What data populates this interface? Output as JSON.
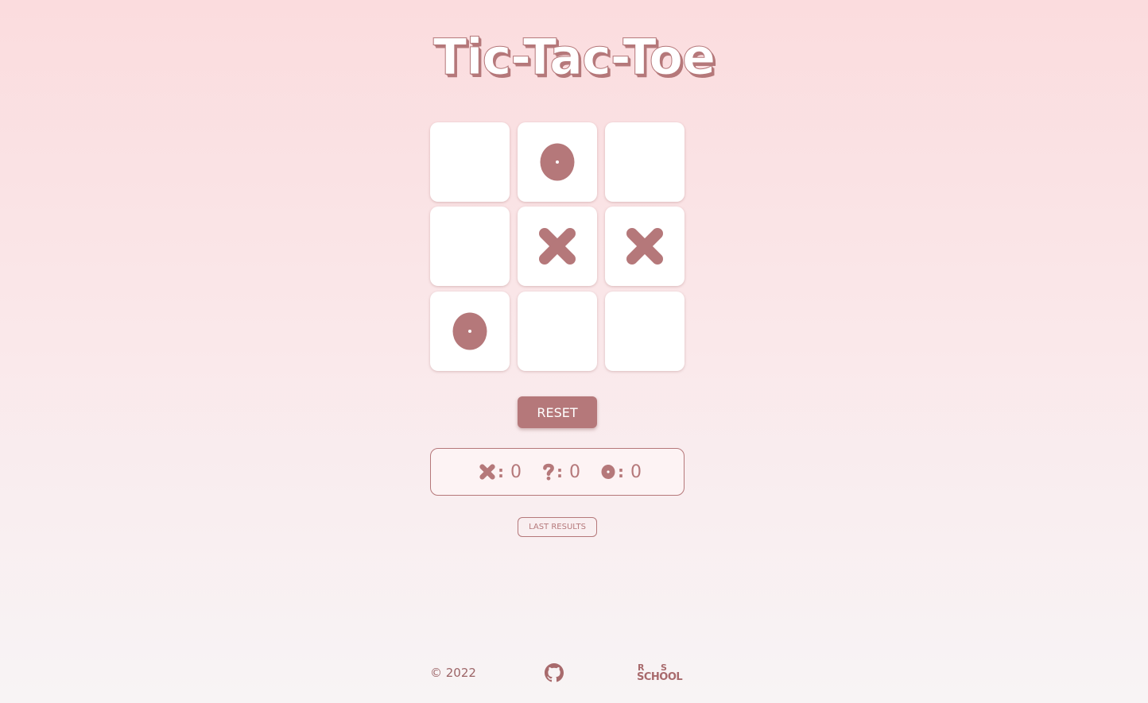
{
  "page": {
    "title": "Tic-Tac-Toe"
  },
  "colors": {
    "accent": "#b5787a",
    "cell_background": "#ffffff",
    "page_background_top": "#fbdcde",
    "page_background_bottom": "#f8f4f5"
  },
  "board": {
    "cells": [
      "",
      "o",
      "",
      "",
      "x",
      "x",
      "o",
      "",
      ""
    ]
  },
  "controls": {
    "reset_label": "RESET",
    "last_results_label": "LAST RESULTS"
  },
  "scores": {
    "x_icon": "cross-icon",
    "x": "0",
    "draw_icon": "question-mark-icon",
    "draw": "0",
    "o_icon": "circle-icon",
    "o": "0"
  },
  "footer": {
    "copyright": "© 2022",
    "github_icon": "github-icon",
    "school_logo": {
      "line1_left": "R",
      "line1_right": "S",
      "line2": "SCHOOL"
    }
  }
}
